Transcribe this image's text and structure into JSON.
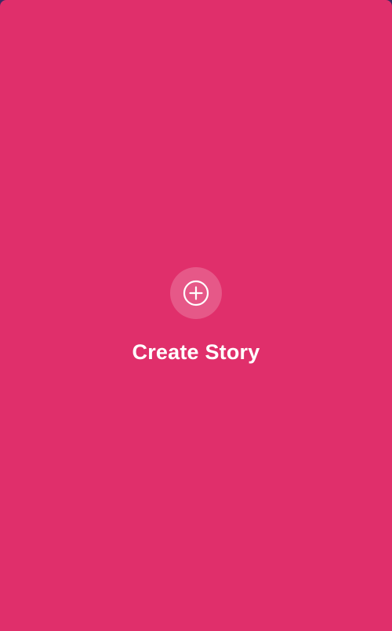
{
  "story_card": {
    "label": "Create Story",
    "icon": "plus-circle-icon",
    "background_color": "#e02f6b",
    "icon_bg_color": "rgba(255,255,255,0.2)",
    "text_color": "#ffffff"
  }
}
